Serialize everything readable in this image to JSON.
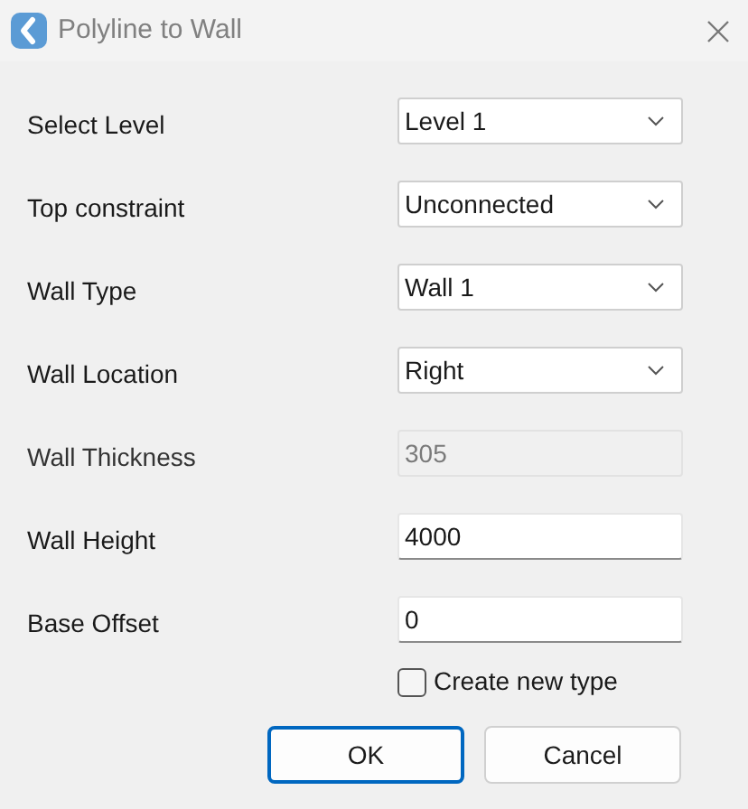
{
  "window": {
    "title": "Polyline to Wall"
  },
  "fields": [
    {
      "label": "Select Level",
      "kind": "dropdown",
      "value": "Level 1"
    },
    {
      "label": "Top constraint",
      "kind": "dropdown",
      "value": "Unconnected"
    },
    {
      "label": "Wall Type",
      "kind": "dropdown",
      "value": "Wall 1"
    },
    {
      "label": "Wall Location",
      "kind": "dropdown",
      "value": "Right"
    },
    {
      "label": "Wall Thickness",
      "kind": "text",
      "value": "305",
      "disabled": true
    },
    {
      "label": "Wall Height",
      "kind": "text",
      "value": "4000",
      "disabled": false
    },
    {
      "label": "Base Offset",
      "kind": "text",
      "value": "0",
      "disabled": false
    }
  ],
  "checkbox": {
    "label": "Create new type",
    "checked": false
  },
  "buttons": [
    {
      "label": "OK",
      "default": true
    },
    {
      "label": "Cancel",
      "default": false
    }
  ]
}
